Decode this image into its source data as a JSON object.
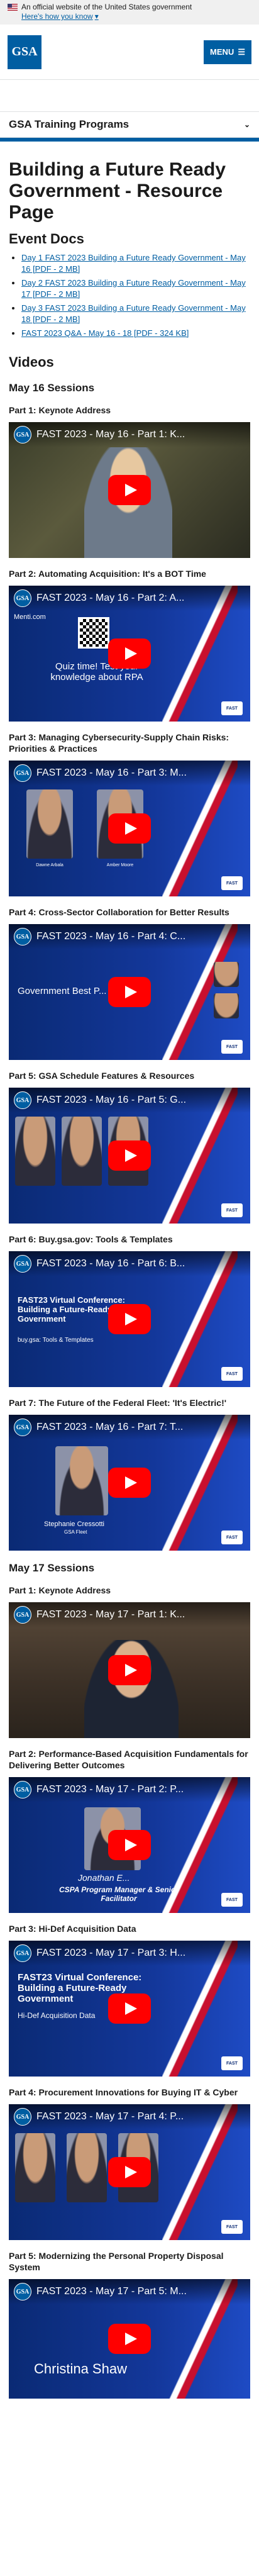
{
  "banner": {
    "text": "An official website of the United States government",
    "link": "Here's how you know"
  },
  "header": {
    "logo": "GSA",
    "menu": "MENU"
  },
  "section_nav": {
    "title": "GSA Training Programs"
  },
  "page": {
    "title": "Building a Future Ready Government - Resource Page"
  },
  "event_docs": {
    "heading": "Event Docs",
    "items": [
      "Day 1 FAST 2023 Building a Future Ready Government - May 16 [PDF - 2 MB]",
      "Day 2 FAST 2023 Building a Future Ready Government - May 17 [PDF - 2 MB]",
      "Day 3 FAST 2023 Building a Future Ready Government - May 18 [PDF - 2 MB]",
      "FAST 2023 Q&A - May 16 - 18 [PDF - 324 KB]"
    ]
  },
  "videos": {
    "heading": "Videos",
    "may16": {
      "heading": "May 16 Sessions",
      "items": [
        {
          "part": "Part 1: Keynote Address",
          "yt_title": "FAST 2023 - May 16 - Part 1: K...",
          "caption": ""
        },
        {
          "part": "Part 2: Automating Acquisition: It's a BOT Time",
          "yt_title": "FAST 2023 - May 16 - Part 2: A...",
          "caption": "Quiz time! Test your knowledge about RPA",
          "caption2": "Menti.com"
        },
        {
          "part": "Part 3: Managing Cybersecurity-Supply Chain Risks: Priorities & Practices",
          "yt_title": "FAST 2023 - May 16 - Part 3: M...",
          "caption": "Dawne Arbala",
          "caption2": "Amber Moore"
        },
        {
          "part": "Part 4: Cross-Sector Collaboration for Better Results",
          "yt_title": "FAST 2023 - May 16 - Part 4: C...",
          "caption": "Government Best P..."
        },
        {
          "part": "Part 5: GSA Schedule Features & Resources",
          "yt_title": "FAST 2023 - May 16 - Part 5: G..."
        },
        {
          "part": "Part 6: Buy.gsa.gov: Tools & Templates",
          "yt_title": "FAST 2023 - May 16 - Part 6: B...",
          "caption": "FAST23 Virtual Conference: Building a Future-Ready Government",
          "caption2": "buy.gsa: Tools & Templates"
        },
        {
          "part": "Part 7: The Future of the Federal Fleet: 'It's Electric!'",
          "yt_title": "FAST 2023 - May 16 - Part 7: T...",
          "caption": "Stephanie Cressotti",
          "caption2": "GSA Fleet"
        }
      ]
    },
    "may17": {
      "heading": "May 17 Sessions",
      "items": [
        {
          "part": "Part 1: Keynote Address",
          "yt_title": "FAST 2023 - May 17 - Part 1: K..."
        },
        {
          "part": "Part 2: Performance-Based Acquisition Fundamentals for Delivering Better Outcomes",
          "yt_title": "FAST 2023 - May 17 - Part 2: P...",
          "caption": "Jonathan E...",
          "caption2": "CSPA Program Manager & Senior Facilitator"
        },
        {
          "part": "Part 3: Hi-Def Acquisition Data",
          "yt_title": "FAST 2023 - May 17 - Part 3: H...",
          "caption": "FAST23 Virtual Conference: Building a Future-Ready Government",
          "caption2": "Hi-Def Acquisition Data"
        },
        {
          "part": "Part 4: Procurement Innovations for Buying IT & Cyber",
          "yt_title": "FAST 2023 - May 17 - Part 4: P..."
        },
        {
          "part": "Part 5: Modernizing the Personal Property Disposal System",
          "yt_title": "FAST 2023 - May 17 - Part 5: M...",
          "caption": "Christina Shaw"
        }
      ]
    }
  }
}
